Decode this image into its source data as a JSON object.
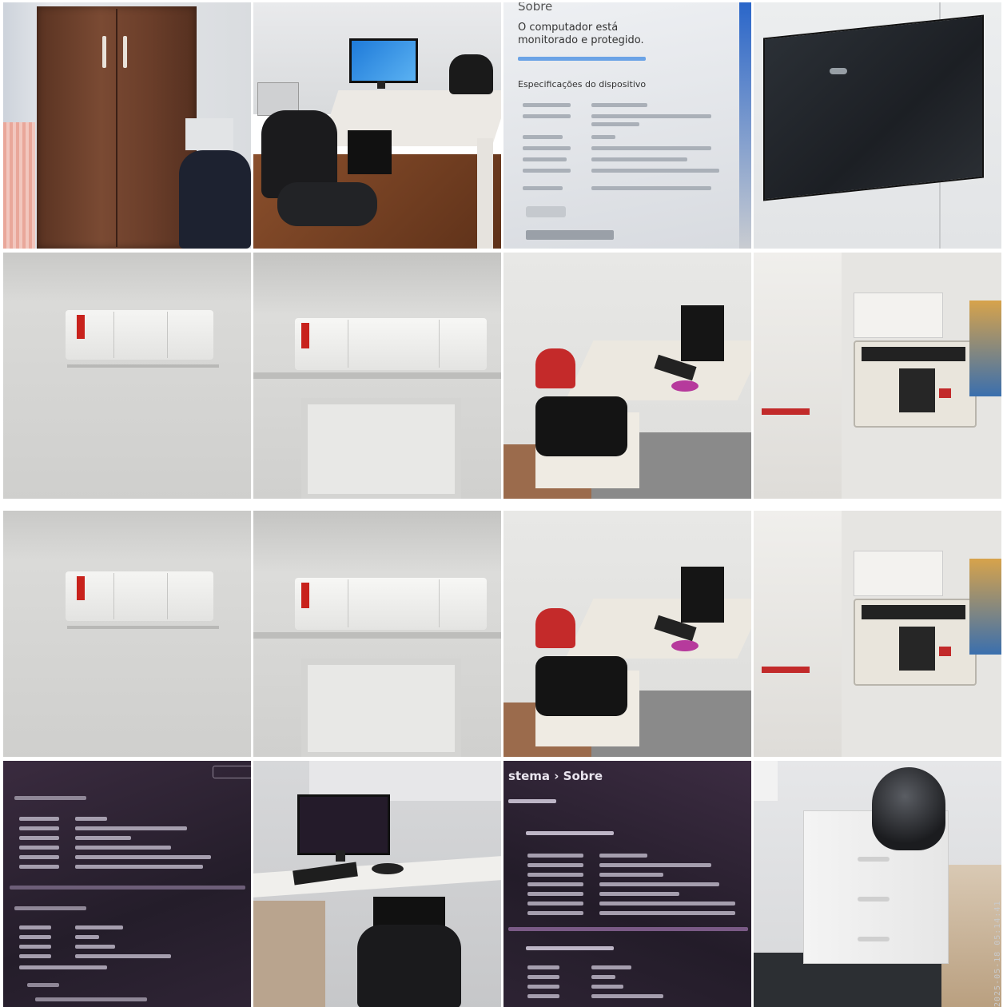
{
  "photos": [
    {
      "id": "wardrobe",
      "caption": ""
    },
    {
      "id": "office-desk-monitor",
      "caption": ""
    },
    {
      "id": "windows-about-light",
      "caption": ""
    },
    {
      "id": "wall-tv",
      "caption": ""
    },
    {
      "id": "ac-unit-1",
      "caption": ""
    },
    {
      "id": "ac-unit-2",
      "caption": ""
    },
    {
      "id": "desk-red-chair",
      "caption": ""
    },
    {
      "id": "calculator-shelf",
      "caption": ""
    },
    {
      "id": "ac-unit-1-dup",
      "caption": ""
    },
    {
      "id": "ac-unit-2-dup",
      "caption": ""
    },
    {
      "id": "desk-red-chair-dup",
      "caption": ""
    },
    {
      "id": "calculator-shelf-dup",
      "caption": ""
    },
    {
      "id": "windows-about-dark",
      "caption": ""
    },
    {
      "id": "workstation-desk",
      "caption": ""
    },
    {
      "id": "windows-about-dark-2",
      "caption": ""
    },
    {
      "id": "helmet-drawer",
      "caption": ""
    }
  ],
  "screen_light": {
    "title": "Sobre",
    "status": "O computador está monitorado e protegido.",
    "link": "Especificações do dispositivo"
  },
  "screen_dark_2": {
    "breadcrumb": "stema › Sobre"
  },
  "side_stamp": "2025-05-18 05:14:41"
}
